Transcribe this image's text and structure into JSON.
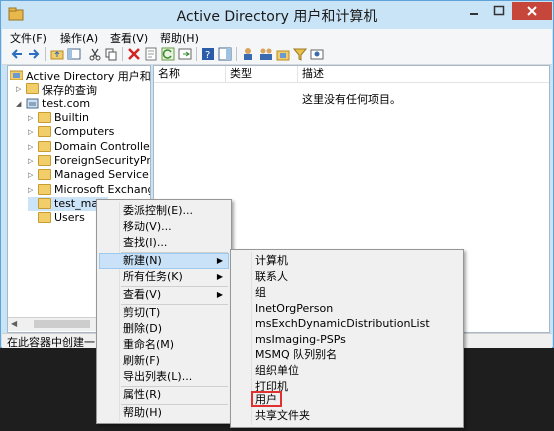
{
  "window": {
    "title": "Active Directory 用户和计算机"
  },
  "menu": [
    "文件(F)",
    "操作(A)",
    "查看(V)",
    "帮助(H)"
  ],
  "tree": {
    "root": "Active Directory 用户和",
    "saved_queries": "保存的查询",
    "domain": "test.com",
    "children": [
      "Builtin",
      "Computers",
      "Domain Controller",
      "ForeignSecurityPr",
      "Managed Service",
      "Microsoft Exchang",
      "test_mai",
      "Users"
    ]
  },
  "list": {
    "columns": [
      "名称",
      "类型",
      "描述"
    ],
    "empty_message": "这里没有任何项目。"
  },
  "status": "在此容器中创建一",
  "context_menu": {
    "items": [
      "委派控制(E)...",
      "移动(V)...",
      "查找(I)...",
      "新建(N)",
      "所有任务(K)",
      "查看(V)",
      "剪切(T)",
      "删除(D)",
      "重命名(M)",
      "刷新(F)",
      "导出列表(L)...",
      "属性(R)",
      "帮助(H)"
    ],
    "highlighted": "新建(N)"
  },
  "submenu": {
    "items": [
      "计算机",
      "联系人",
      "组",
      "InetOrgPerson",
      "msExchDynamicDistributionList",
      "msImaging-PSPs",
      "MSMQ 队列别名",
      "组织单位",
      "打印机",
      "用户",
      "共享文件夹"
    ],
    "boxed": "用户",
    "box_color": "#e0312e"
  }
}
